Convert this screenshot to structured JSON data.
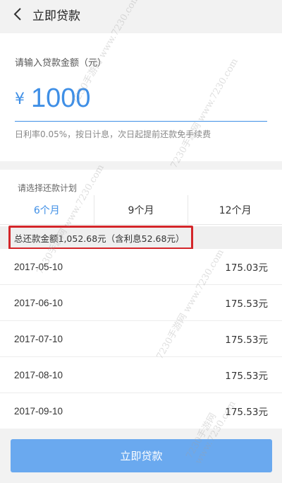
{
  "header": {
    "title": "立即贷款",
    "back_icon": "chevron-left-icon"
  },
  "amount": {
    "prompt": "请输入贷款金额（元）",
    "currency_symbol": "¥",
    "value": "1000",
    "rate_note": "日利率0.05%，按日计息，次日起提前还款免手续费"
  },
  "plan": {
    "prompt": "请选择还款计划",
    "tabs": [
      {
        "label": "6个月",
        "active": true
      },
      {
        "label": "9个月",
        "active": false
      },
      {
        "label": "12个月",
        "active": false
      }
    ],
    "summary": "总还款金额1,052.68元（含利息52.68元）",
    "schedule": [
      {
        "date": "2017-05-10",
        "amount": "175.03元"
      },
      {
        "date": "2017-06-10",
        "amount": "175.53元"
      },
      {
        "date": "2017-07-10",
        "amount": "175.53元"
      },
      {
        "date": "2017-08-10",
        "amount": "175.53元"
      },
      {
        "date": "2017-09-10",
        "amount": "175.53元"
      }
    ]
  },
  "submit_label": "立即贷款",
  "watermark_text": "7230手游网 www.7230.com",
  "colors": {
    "accent": "#3f8fe6",
    "button": "#6aa9ef",
    "highlight": "#d4262a"
  }
}
